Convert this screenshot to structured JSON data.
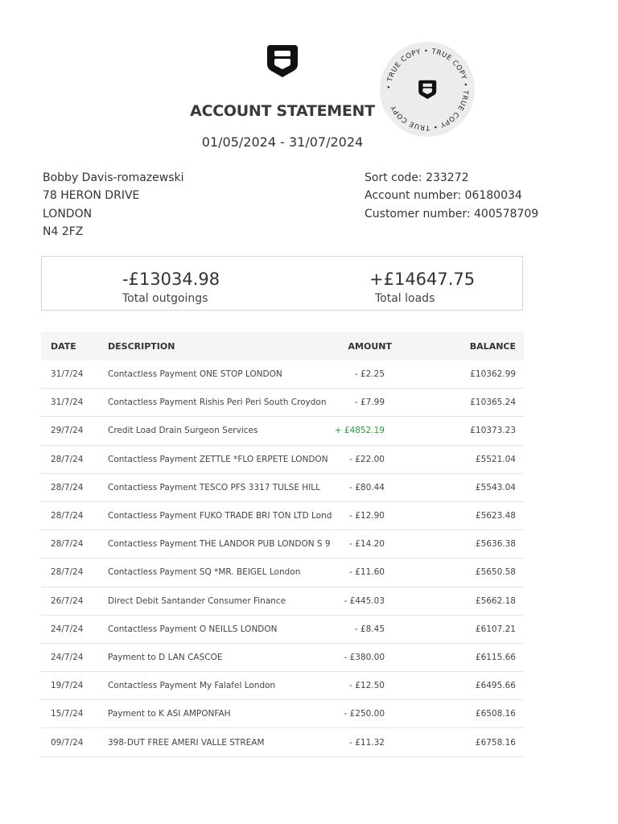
{
  "header": {
    "title": "ACCOUNT STATEMENT",
    "period": "01/05/2024 - 31/07/2024",
    "logo_icon": "shield-logo-icon"
  },
  "stamp": {
    "text": "• TRUE COPY • TRUE COPY • TRUE COPY • TRUE COPY",
    "icon": "shield-logo-icon"
  },
  "customer": {
    "name": "Bobby Davis-romazewski",
    "address_line1": "78 HERON DRIVE",
    "city": "LONDON",
    "postcode": "N4 2FZ"
  },
  "account": {
    "sort_code": "Sort code: 233272",
    "account_number": "Account number: 06180034",
    "customer_number": "Customer number: 400578709"
  },
  "summary": {
    "outgoings_amount": "-£13034.98",
    "outgoings_label": "Total outgoings",
    "loads_amount": "+£14647.75",
    "loads_label": "Total loads"
  },
  "table": {
    "headers": {
      "date": "DATE",
      "description": "DESCRIPTION",
      "amount": "AMOUNT",
      "balance": "BALANCE"
    },
    "rows": [
      {
        "date": "31/7/24",
        "description": "Contactless Payment ONE STOP LONDON",
        "amount": "- £2.25",
        "balance": "£10362.99"
      },
      {
        "date": "31/7/24",
        "description": "Contactless Payment Rishis Peri Peri South Croydon",
        "amount": "- £7.99",
        "balance": "£10365.24"
      },
      {
        "date": "29/7/24",
        "description": "Credit Load Drain Surgeon Services",
        "amount": "+ £4852.19",
        "balance": "£10373.23"
      },
      {
        "date": "28/7/24",
        "description": "Contactless Payment ZETTLE  *FLO   ERPETE LONDON",
        "amount": "- £22.00",
        "balance": "£5521.04"
      },
      {
        "date": "28/7/24",
        "description": "Contactless Payment TESCO PFS 3317 TULSE HILL",
        "amount": "- £80.44",
        "balance": "£5543.04"
      },
      {
        "date": "28/7/24",
        "description": "Contactless Payment FUKO TRADE BRI  TON LTD London",
        "amount": "- £12.90",
        "balance": "£5623.48"
      },
      {
        "date": "28/7/24",
        "description": "Contactless Payment THE LANDOR PUB LONDON S   9",
        "amount": "- £14.20",
        "balance": "£5636.38"
      },
      {
        "date": "28/7/24",
        "description": "Contactless Payment SQ *MR. BEIGEL London",
        "amount": "- £11.60",
        "balance": "£5650.58"
      },
      {
        "date": "26/7/24",
        "description": "Direct Debit Santander Consumer Finance",
        "amount": "- £445.03",
        "balance": "£5662.18"
      },
      {
        "date": "24/7/24",
        "description": "Contactless Payment O NEILLS LONDON",
        "amount": "- £8.45",
        "balance": "£6107.21"
      },
      {
        "date": "24/7/24",
        "description": "Payment to D  LAN CASCOE",
        "amount": "- £380.00",
        "balance": "£6115.66"
      },
      {
        "date": "19/7/24",
        "description": "Contactless Payment My Falafel London",
        "amount": "- £12.50",
        "balance": "£6495.66"
      },
      {
        "date": "15/7/24",
        "description": "Payment to K   ASI AMPONFAH",
        "amount": "- £250.00",
        "balance": "£6508.16"
      },
      {
        "date": "09/7/24",
        "description": "398-DUT   FREE AMERI VALLE   STREAM",
        "amount": "- £11.32",
        "balance": "£6758.16"
      }
    ]
  },
  "colors": {
    "positive": "#2e9b3a",
    "text": "#333333",
    "header_bg": "#f5f5f5",
    "stamp_bg": "#ececec"
  }
}
